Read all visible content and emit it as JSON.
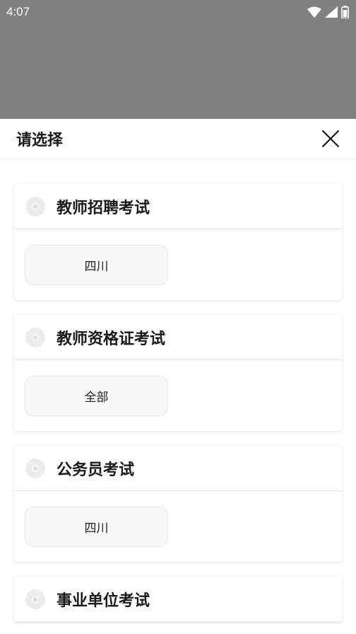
{
  "status_bar": {
    "time": "4:07",
    "icons": [
      "wifi-icon",
      "signal-icon",
      "battery-icon"
    ]
  },
  "sheet": {
    "title": "请选择",
    "close_icon": "close-icon"
  },
  "categories": [
    {
      "title": "教师招聘考试",
      "option": "四川"
    },
    {
      "title": "教师资格证考试",
      "option": "全部"
    },
    {
      "title": "公务员考试",
      "option": "四川"
    },
    {
      "title": "事业单位考试"
    }
  ],
  "colors": {
    "overlay": "#808080",
    "sheet_bg": "#ffffff",
    "chip_bg": "#f7f7f7",
    "text": "#1a1a1a"
  }
}
